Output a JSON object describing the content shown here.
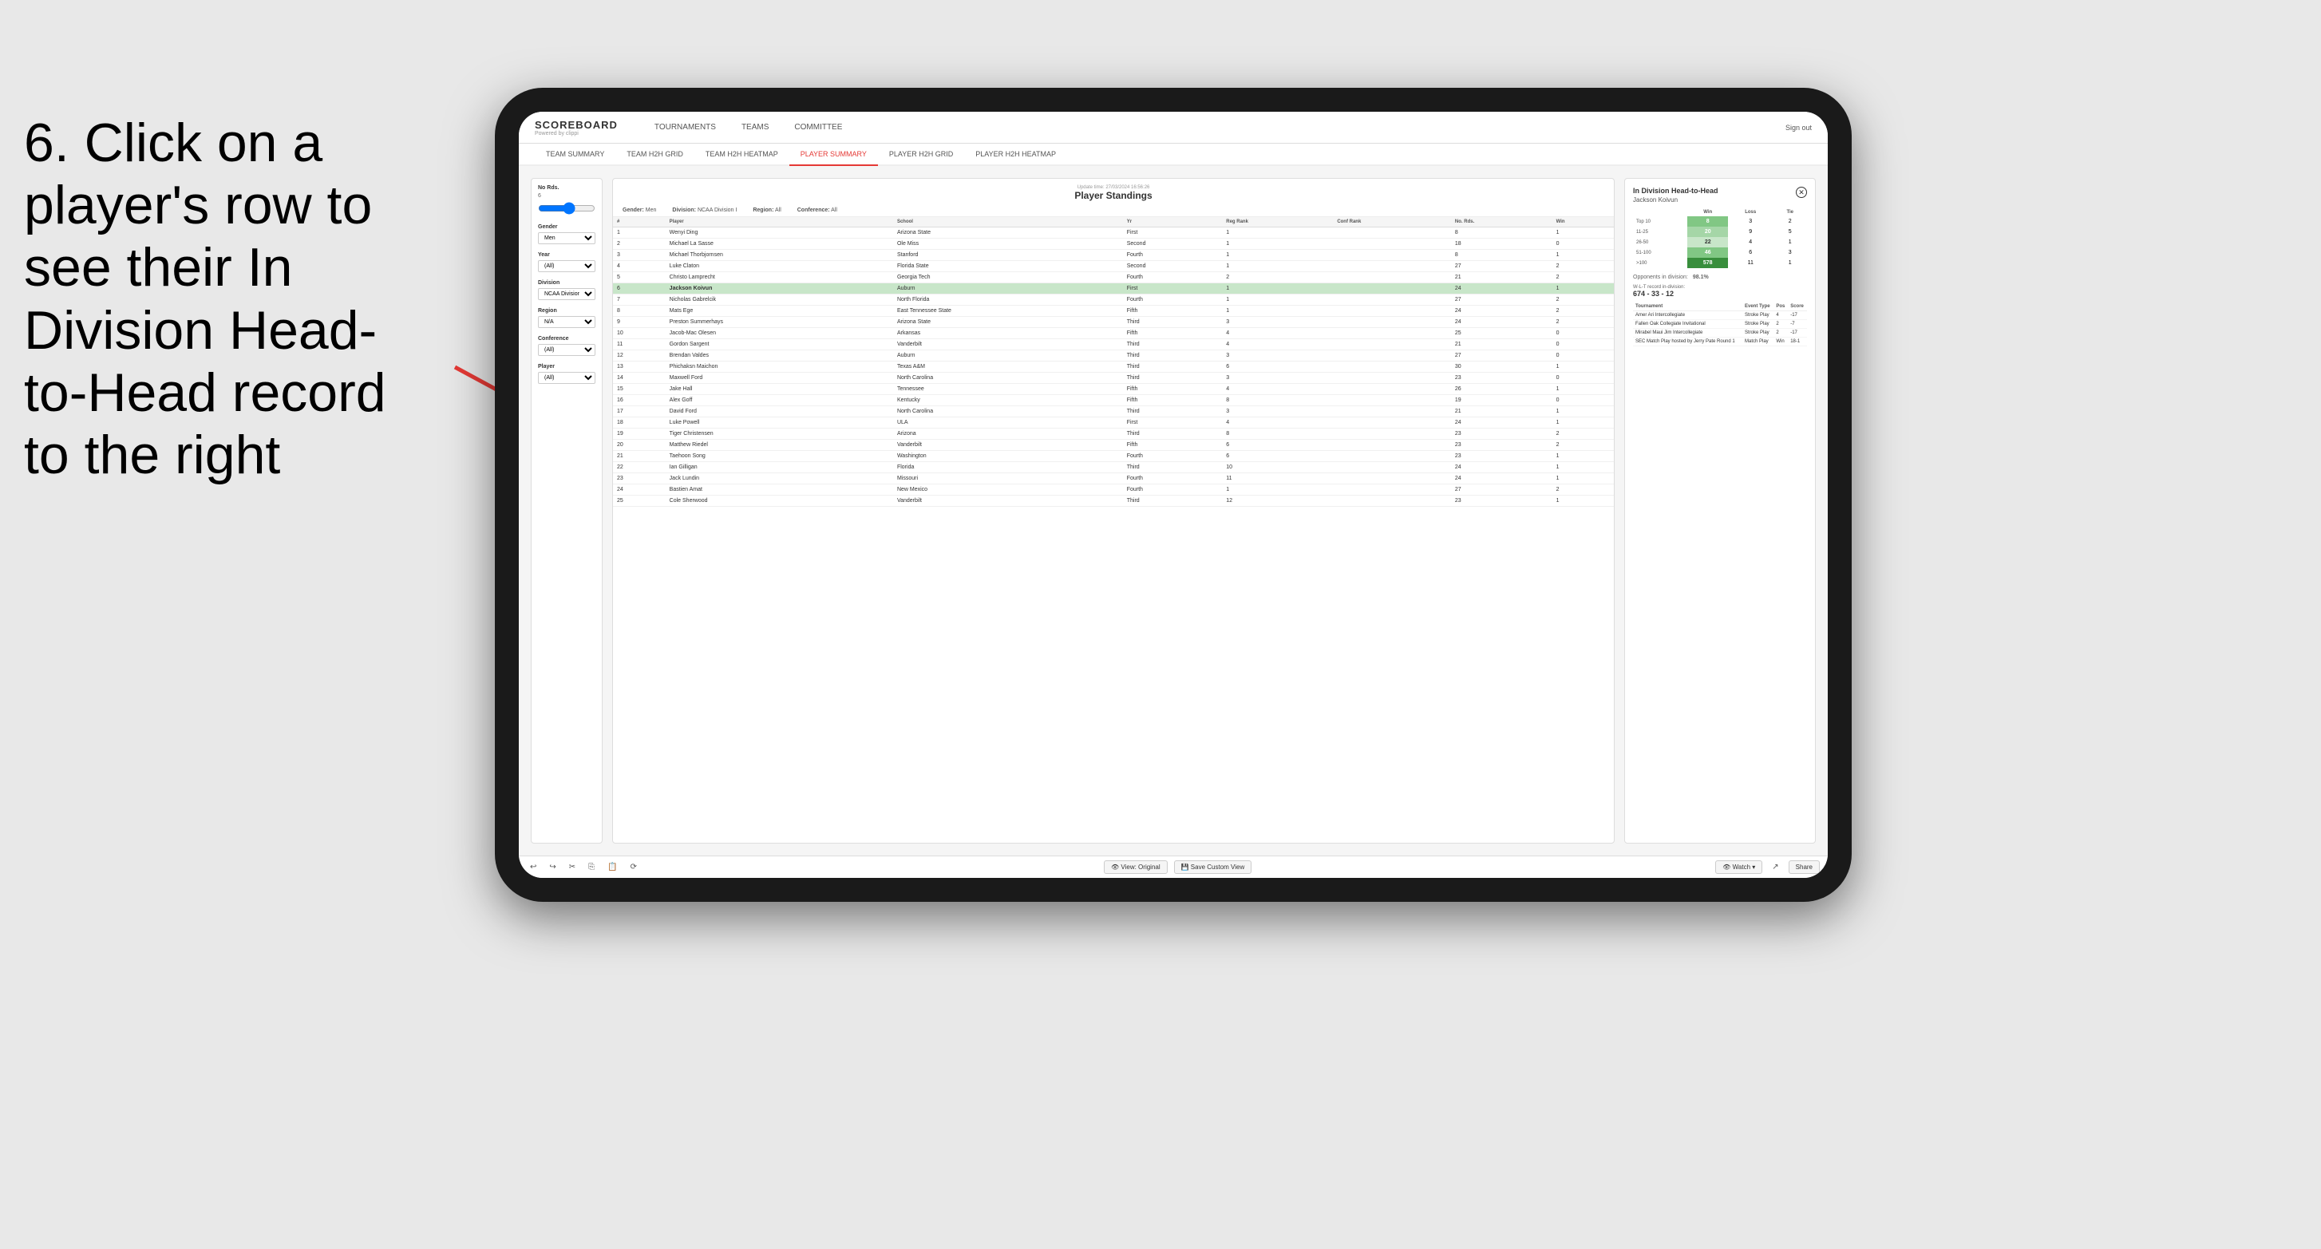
{
  "instruction": {
    "step": "6.",
    "text": "Click on a player's row to see their In Division Head-to-Head record to the right"
  },
  "nav": {
    "logo": "SCOREBOARD",
    "logo_sub": "Powered by clippi",
    "links": [
      "TOURNAMENTS",
      "TEAMS",
      "COMMITTEE"
    ],
    "sign_out": "Sign out"
  },
  "sub_nav": {
    "links": [
      "TEAM SUMMARY",
      "TEAM H2H GRID",
      "TEAM H2H HEATMAP",
      "PLAYER SUMMARY",
      "PLAYER H2H GRID",
      "PLAYER H2H HEATMAP"
    ],
    "active": "PLAYER SUMMARY"
  },
  "filters": {
    "no_rds_label": "No Rds.",
    "no_rds_value": "6",
    "gender_label": "Gender",
    "gender_value": "Men",
    "year_label": "Year",
    "year_value": "(All)",
    "division_label": "Division",
    "division_value": "NCAA Division I",
    "region_label": "Region",
    "region_value": "N/A",
    "conference_label": "Conference",
    "conference_value": "(All)",
    "player_label": "Player",
    "player_value": "(All)"
  },
  "standings": {
    "title": "Player Standings",
    "update_label": "Update time:",
    "update_time": "27/03/2024 16:56:26",
    "gender_label": "Gender:",
    "gender_value": "Men",
    "division_label": "Division:",
    "division_value": "NCAA Division I",
    "region_label": "Region:",
    "region_value": "All",
    "conference_label": "Conference:",
    "conference_value": "All",
    "columns": [
      "#",
      "Player",
      "School",
      "Yr",
      "Reg Rank",
      "Conf Rank",
      "No. Rds.",
      "Win"
    ],
    "rows": [
      {
        "num": 1,
        "player": "Wenyi Ding",
        "school": "Arizona State",
        "yr": "First",
        "reg_rank": 1,
        "conf_rank": "",
        "no_rds": 8,
        "win": 1
      },
      {
        "num": 2,
        "player": "Michael La Sasse",
        "school": "Ole Miss",
        "yr": "Second",
        "reg_rank": 1,
        "conf_rank": "",
        "no_rds": 18,
        "win": 0
      },
      {
        "num": 3,
        "player": "Michael Thorbjornsen",
        "school": "Stanford",
        "yr": "Fourth",
        "reg_rank": 1,
        "conf_rank": "",
        "no_rds": 8,
        "win": 1
      },
      {
        "num": 4,
        "player": "Luke Claton",
        "school": "Florida State",
        "yr": "Second",
        "reg_rank": 1,
        "conf_rank": "",
        "no_rds": 27,
        "win": 2
      },
      {
        "num": 5,
        "player": "Christo Lamprecht",
        "school": "Georgia Tech",
        "yr": "Fourth",
        "reg_rank": 2,
        "conf_rank": "",
        "no_rds": 21,
        "win": 2
      },
      {
        "num": 6,
        "player": "Jackson Koivun",
        "school": "Auburn",
        "yr": "First",
        "reg_rank": 1,
        "conf_rank": "",
        "no_rds": 24,
        "win": 1,
        "selected": true
      },
      {
        "num": 7,
        "player": "Nicholas Gabrelcik",
        "school": "North Florida",
        "yr": "Fourth",
        "reg_rank": 1,
        "conf_rank": "",
        "no_rds": 27,
        "win": 2
      },
      {
        "num": 8,
        "player": "Mats Ege",
        "school": "East Tennessee State",
        "yr": "Fifth",
        "reg_rank": 1,
        "conf_rank": "",
        "no_rds": 24,
        "win": 2
      },
      {
        "num": 9,
        "player": "Preston Summerhays",
        "school": "Arizona State",
        "yr": "Third",
        "reg_rank": 3,
        "conf_rank": "",
        "no_rds": 24,
        "win": 2
      },
      {
        "num": 10,
        "player": "Jacob-Mac Olesen",
        "school": "Arkansas",
        "yr": "Fifth",
        "reg_rank": 4,
        "conf_rank": "",
        "no_rds": 25,
        "win": 0
      },
      {
        "num": 11,
        "player": "Gordon Sargent",
        "school": "Vanderbilt",
        "yr": "Third",
        "reg_rank": 4,
        "conf_rank": "",
        "no_rds": 21,
        "win": 0
      },
      {
        "num": 12,
        "player": "Brendan Valdes",
        "school": "Auburn",
        "yr": "Third",
        "reg_rank": 3,
        "conf_rank": "",
        "no_rds": 27,
        "win": 0
      },
      {
        "num": 13,
        "player": "Phichaksn Maichon",
        "school": "Texas A&M",
        "yr": "Third",
        "reg_rank": 6,
        "conf_rank": "",
        "no_rds": 30,
        "win": 1
      },
      {
        "num": 14,
        "player": "Maxwell Ford",
        "school": "North Carolina",
        "yr": "Third",
        "reg_rank": 3,
        "conf_rank": "",
        "no_rds": 23,
        "win": 0
      },
      {
        "num": 15,
        "player": "Jake Hall",
        "school": "Tennessee",
        "yr": "Fifth",
        "reg_rank": 4,
        "conf_rank": "",
        "no_rds": 26,
        "win": 1
      },
      {
        "num": 16,
        "player": "Alex Goff",
        "school": "Kentucky",
        "yr": "Fifth",
        "reg_rank": 8,
        "conf_rank": "",
        "no_rds": 19,
        "win": 0
      },
      {
        "num": 17,
        "player": "David Ford",
        "school": "North Carolina",
        "yr": "Third",
        "reg_rank": 3,
        "conf_rank": "",
        "no_rds": 21,
        "win": 1
      },
      {
        "num": 18,
        "player": "Luke Powell",
        "school": "ULA",
        "yr": "First",
        "reg_rank": 4,
        "conf_rank": "",
        "no_rds": 24,
        "win": 1
      },
      {
        "num": 19,
        "player": "Tiger Christensen",
        "school": "Arizona",
        "yr": "Third",
        "reg_rank": 8,
        "conf_rank": "",
        "no_rds": 23,
        "win": 2
      },
      {
        "num": 20,
        "player": "Matthew Riedel",
        "school": "Vanderbilt",
        "yr": "Fifth",
        "reg_rank": 6,
        "conf_rank": "",
        "no_rds": 23,
        "win": 2
      },
      {
        "num": 21,
        "player": "Taehoon Song",
        "school": "Washington",
        "yr": "Fourth",
        "reg_rank": 6,
        "conf_rank": "",
        "no_rds": 23,
        "win": 1
      },
      {
        "num": 22,
        "player": "Ian Gilligan",
        "school": "Florida",
        "yr": "Third",
        "reg_rank": 10,
        "conf_rank": "",
        "no_rds": 24,
        "win": 1
      },
      {
        "num": 23,
        "player": "Jack Lundin",
        "school": "Missouri",
        "yr": "Fourth",
        "reg_rank": 11,
        "conf_rank": "",
        "no_rds": 24,
        "win": 1
      },
      {
        "num": 24,
        "player": "Bastien Amat",
        "school": "New Mexico",
        "yr": "Fourth",
        "reg_rank": 1,
        "conf_rank": "",
        "no_rds": 27,
        "win": 2
      },
      {
        "num": 25,
        "player": "Cole Sherwood",
        "school": "Vanderbilt",
        "yr": "Third",
        "reg_rank": 12,
        "conf_rank": "",
        "no_rds": 23,
        "win": 1
      }
    ]
  },
  "h2h": {
    "title": "In Division Head-to-Head",
    "player_name": "Jackson Koivun",
    "table_headers": [
      "",
      "Win",
      "Loss",
      "Tie"
    ],
    "rows": [
      {
        "label": "Top 10",
        "win": 8,
        "loss": 3,
        "tie": 2
      },
      {
        "label": "11-25",
        "win": 20,
        "loss": 9,
        "tie": 5
      },
      {
        "label": "26-50",
        "win": 22,
        "loss": 4,
        "tie": 1
      },
      {
        "label": "51-100",
        "win": 46,
        "loss": 6,
        "tie": 3
      },
      {
        "label": ">100",
        "win": 578,
        "loss": 11,
        "tie": 1
      }
    ],
    "opponents_label": "Opponents in division:",
    "opponents_value": "98.1%",
    "record_label": "W-L-T record in-division:",
    "record_value": "674 - 33 - 12",
    "tournament_columns": [
      "Tournament",
      "Event Type",
      "Pos",
      "Score"
    ],
    "tournaments": [
      {
        "name": "Amer Ari Intercollegiate",
        "type": "Stroke Play",
        "pos": 4,
        "score": "-17"
      },
      {
        "name": "Fallen Oak Collegiate Invitational",
        "type": "Stroke Play",
        "pos": 2,
        "score": "-7"
      },
      {
        "name": "Mirabel Maui Jim Intercollegiate",
        "type": "Stroke Play",
        "pos": 2,
        "score": "-17"
      },
      {
        "name": "SEC Match Play hosted by Jerry Pate Round 1",
        "type": "Match Play",
        "pos": "Win",
        "score": "18-1"
      }
    ]
  },
  "toolbar": {
    "undo": "↩",
    "redo": "↪",
    "view_original": "View: Original",
    "save_custom": "Save Custom View",
    "watch": "Watch ▾",
    "share": "Share"
  }
}
